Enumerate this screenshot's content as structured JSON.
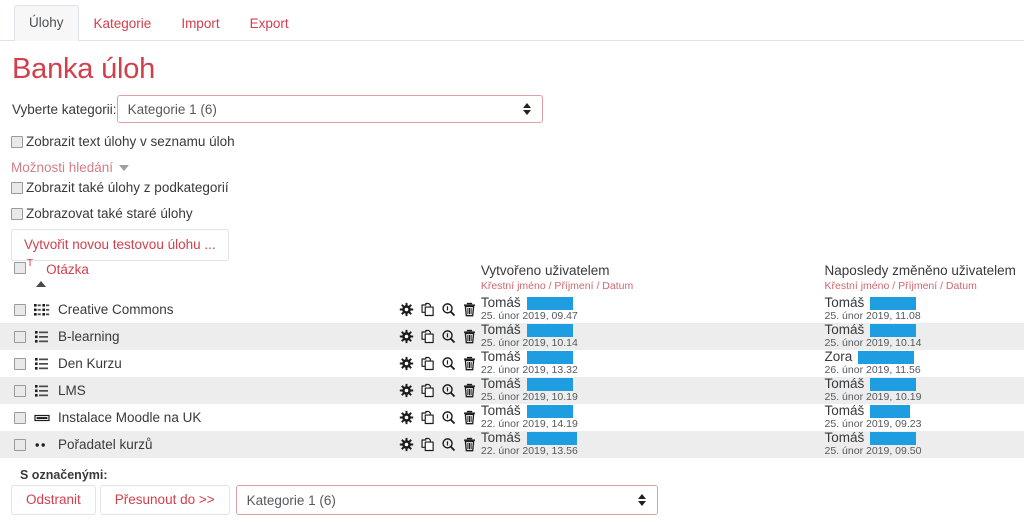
{
  "tabs": [
    {
      "label": "Úlohy",
      "active": true
    },
    {
      "label": "Kategorie",
      "active": false
    },
    {
      "label": "Import",
      "active": false
    },
    {
      "label": "Export",
      "active": false
    }
  ],
  "page_title": "Banka úloh",
  "category_chooser": {
    "label": "Vyberte kategorii:",
    "value": "Kategorie 1 (6)",
    "options": [
      "Kategorie 1 (6)"
    ]
  },
  "options": {
    "show_question_text": {
      "label": "Zobrazit text úlohy v seznamu úloh",
      "checked": false
    },
    "search_options_toggle": {
      "label": "Možnosti hledání",
      "icon": "chevron-down-icon"
    },
    "show_subcategories": {
      "label": "Zobrazit také úlohy z podkategorií",
      "checked": false
    },
    "show_old_questions": {
      "label": "Zobrazovat také staré úlohy",
      "checked": false
    }
  },
  "create_button": {
    "label": "Vytvořit novou testovou úlohu ..."
  },
  "table": {
    "headers": {
      "question": {
        "label": "Otázka",
        "superscript": "T",
        "sort": "ascending"
      },
      "created": {
        "title": "Vytvořeno uživatelem",
        "sub": "Křestní jméno / Příjmení / Datum"
      },
      "modified": {
        "title": "Naposledy změněno uživatelem",
        "sub": "Křestní jméno / Příjmení / Datum"
      }
    },
    "action_icons": [
      "gear-icon",
      "duplicate-icon",
      "preview-magnifier-icon",
      "trash-icon"
    ],
    "rows": [
      {
        "name": "Creative Commons",
        "qtype": "multichoice-multi-icon",
        "created_user": "Tomáš",
        "created_redact_width": 46,
        "created_date": "25. únor 2019, 09.47",
        "modified_user": "Tomáš",
        "modified_redact_width": 46,
        "modified_date": "25. únor 2019, 11.08"
      },
      {
        "name": "B-learning",
        "qtype": "multichoice-single-icon",
        "created_user": "Tomáš",
        "created_redact_width": 46,
        "created_date": "25. únor 2019, 10.14",
        "modified_user": "Tomáš",
        "modified_redact_width": 46,
        "modified_date": "25. únor 2019, 10.14"
      },
      {
        "name": "Den Kurzu",
        "qtype": "multichoice-single-icon",
        "created_user": "Tomáš",
        "created_redact_width": 46,
        "created_date": "22. únor 2019, 13.32",
        "modified_user": "Zora",
        "modified_redact_width": 56,
        "modified_date": "26. únor 2019, 11.56"
      },
      {
        "name": "LMS",
        "qtype": "multichoice-single-icon",
        "created_user": "Tomáš",
        "created_redact_width": 46,
        "created_date": "25. únor 2019, 10.19",
        "modified_user": "Tomáš",
        "modified_redact_width": 46,
        "modified_date": "25. únor 2019, 10.19"
      },
      {
        "name": "Instalace Moodle na UK",
        "qtype": "shortanswer-icon",
        "created_user": "Tomáš",
        "created_redact_width": 46,
        "created_date": "22. únor 2019, 14.19",
        "modified_user": "Tomáš",
        "modified_redact_width": 40,
        "modified_date": "25. únor 2019, 09.23"
      },
      {
        "name": "Pořadatel kurzů",
        "qtype": "truefalse-icon",
        "created_user": "Tomáš",
        "created_redact_width": 50,
        "created_date": "22. únor 2019, 13.56",
        "modified_user": "Tomáš",
        "modified_redact_width": 46,
        "modified_date": "25. únor 2019, 09.50"
      }
    ]
  },
  "bulk": {
    "label": "S označenými:",
    "delete_label": "Odstranit",
    "move_label": "Přesunout do >>",
    "select_value": "Kategorie 1 (6)",
    "select_options": [
      "Kategorie 1 (6)"
    ]
  },
  "colors": {
    "accent": "#d23f4b",
    "redaction": "#1e9ee0",
    "row_alt": "#ededed",
    "border": "#dee2e6"
  }
}
